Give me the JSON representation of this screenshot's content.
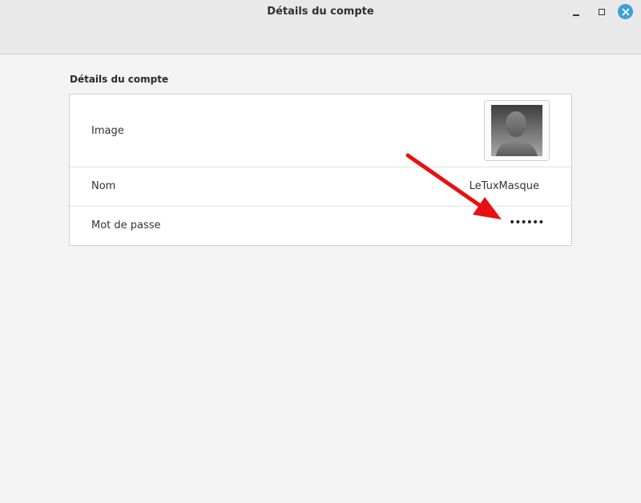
{
  "window": {
    "title": "Détails du compte",
    "controls": {
      "minimize_icon": "minimize-icon",
      "maximize_icon": "maximize-icon",
      "close_icon": "close-icon",
      "close_color": "#3da0d8"
    }
  },
  "section": {
    "title": "Détails du compte"
  },
  "rows": {
    "image": {
      "label": "Image",
      "avatar_icon": "user-silhouette-icon"
    },
    "name": {
      "label": "Nom",
      "value": "LeTuxMasque"
    },
    "password": {
      "label": "Mot de passe",
      "value": "••••••"
    }
  },
  "annotation": {
    "icon": "red-arrow-icon",
    "color": "#e81010"
  }
}
